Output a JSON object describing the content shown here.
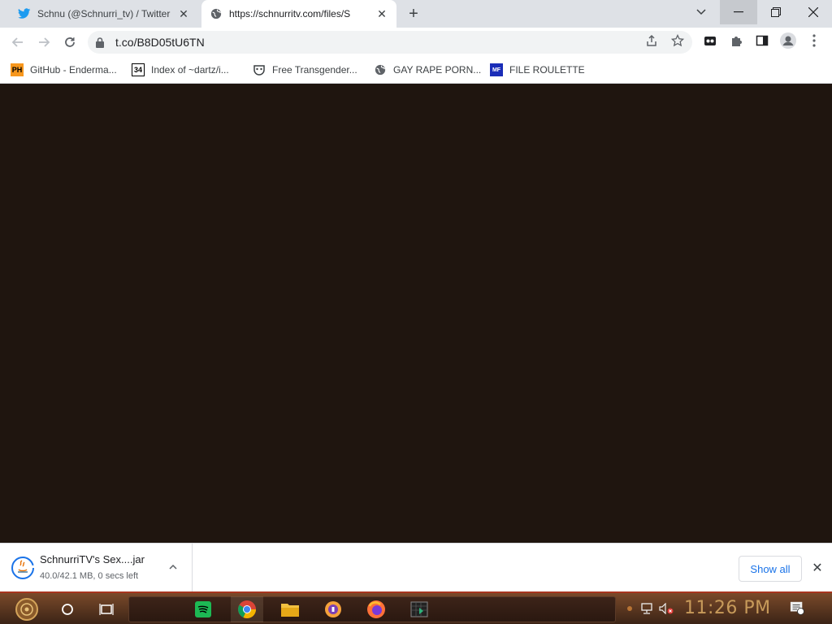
{
  "tabs": [
    {
      "title": "Schnu (@Schnurri_tv) / Twitter",
      "close": "✕"
    },
    {
      "title": "https://schnurritv.com/files/S",
      "close": "✕"
    }
  ],
  "new_tab": "+",
  "omnibox": {
    "url": "t.co/B8D05tU6TN"
  },
  "bookmarks": [
    {
      "icon": "PH",
      "label": "GitHub - Enderma..."
    },
    {
      "icon": "34",
      "label": "Index of ~dartz/i..."
    },
    {
      "icon": "",
      "label": "Free Transgender..."
    },
    {
      "icon": "",
      "label": "GAY RAPE PORN..."
    },
    {
      "icon": "MF",
      "label": "FILE ROULETTE"
    }
  ],
  "download": {
    "filename": "SchnurriTV's Sex....jar",
    "status": "40.0/42.1 MB, 0 secs left",
    "show_all": "Show all",
    "close": "✕"
  },
  "taskbar": {
    "clock": "11:26 PM"
  },
  "colors": {
    "content_bg": "#1f150f",
    "accent_link": "#1a73e8",
    "taskbar_border": "#a8351e",
    "clock": "#c79a5a"
  }
}
